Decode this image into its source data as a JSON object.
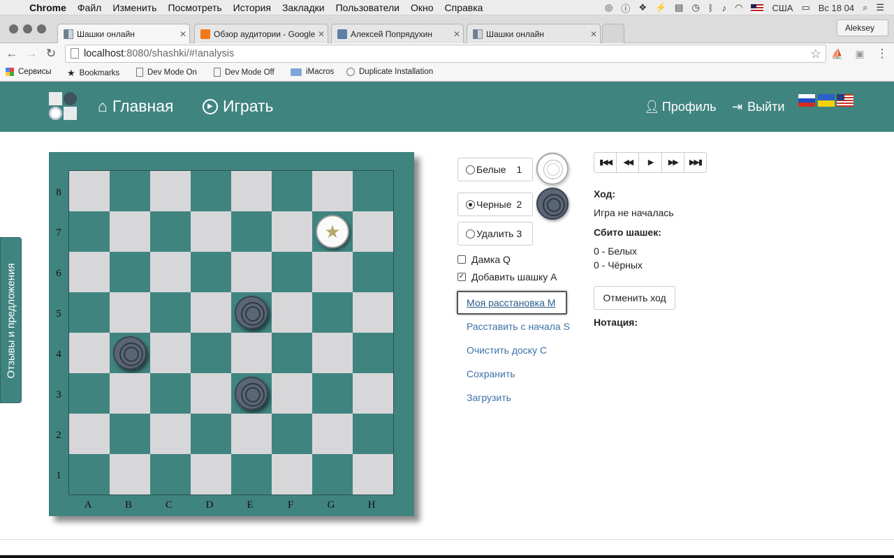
{
  "os_menubar": {
    "app_name": "Chrome",
    "menus": [
      "Файл",
      "Изменить",
      "Посмотреть",
      "История",
      "Закладки",
      "Пользователи",
      "Окно",
      "Справка"
    ],
    "keyboard_layout": "США",
    "clock": "Вс 18 04"
  },
  "browser": {
    "tabs": [
      {
        "title": "Шашки онлайн",
        "active": true
      },
      {
        "title": "Обзор аудитории - Google",
        "active": false
      },
      {
        "title": "Алексей Попрядухин",
        "active": false
      },
      {
        "title": "Шашки онлайн",
        "active": false
      }
    ],
    "profile_name": "Aleksey",
    "url_host": "localhost",
    "url_path": ":8080/shashki/#!analysis",
    "bookmarks": [
      "Сервисы",
      "Bookmarks",
      "Dev Mode On",
      "Dev Mode Off",
      "iMacros",
      "Duplicate Installation"
    ]
  },
  "site_nav": {
    "home": "Главная",
    "play": "Играть",
    "profile": "Профиль",
    "logout": "Выйти",
    "languages": [
      "ru",
      "ua",
      "us"
    ]
  },
  "board": {
    "files": [
      "A",
      "B",
      "C",
      "D",
      "E",
      "F",
      "G",
      "H"
    ],
    "ranks": [
      "8",
      "7",
      "6",
      "5",
      "4",
      "3",
      "2",
      "1"
    ],
    "pieces": [
      {
        "square": "G7",
        "color": "white",
        "king": true
      },
      {
        "square": "E5",
        "color": "black",
        "king": false
      },
      {
        "square": "B4",
        "color": "black",
        "king": false
      },
      {
        "square": "E3",
        "color": "black",
        "king": false
      }
    ],
    "king_symbol": "★"
  },
  "controls": {
    "white_label": "Белые",
    "white_key": "1",
    "black_label": "Черные",
    "black_key": "2",
    "remove_label": "Удалить 3",
    "selected": "black",
    "king_checkbox": "Дамка Q",
    "king_checked": false,
    "add_checkbox": "Добавить шашку А",
    "add_checked": true,
    "my_arrangement": "Моя расстановка М",
    "arrange_start": "Расставить с начала S",
    "clear_board": "Очистить доску С",
    "save": "Сохранить",
    "load": "Загрузить"
  },
  "game_panel": {
    "move_heading": "Ход:",
    "move_status": "Игра не началась",
    "captured_heading": "Сбито шашек:",
    "captured_white": "0 - Белых",
    "captured_black": "0 - Чёрных",
    "undo_button": "Отменить ход",
    "notation_heading": "Нотация:"
  },
  "feedback_tab": "Отзывы и предложения",
  "colors": {
    "brand_teal": "#408480",
    "light_square": "#d7d7d9",
    "black_piece": "#5a6675",
    "link_blue": "#3b73a8"
  }
}
